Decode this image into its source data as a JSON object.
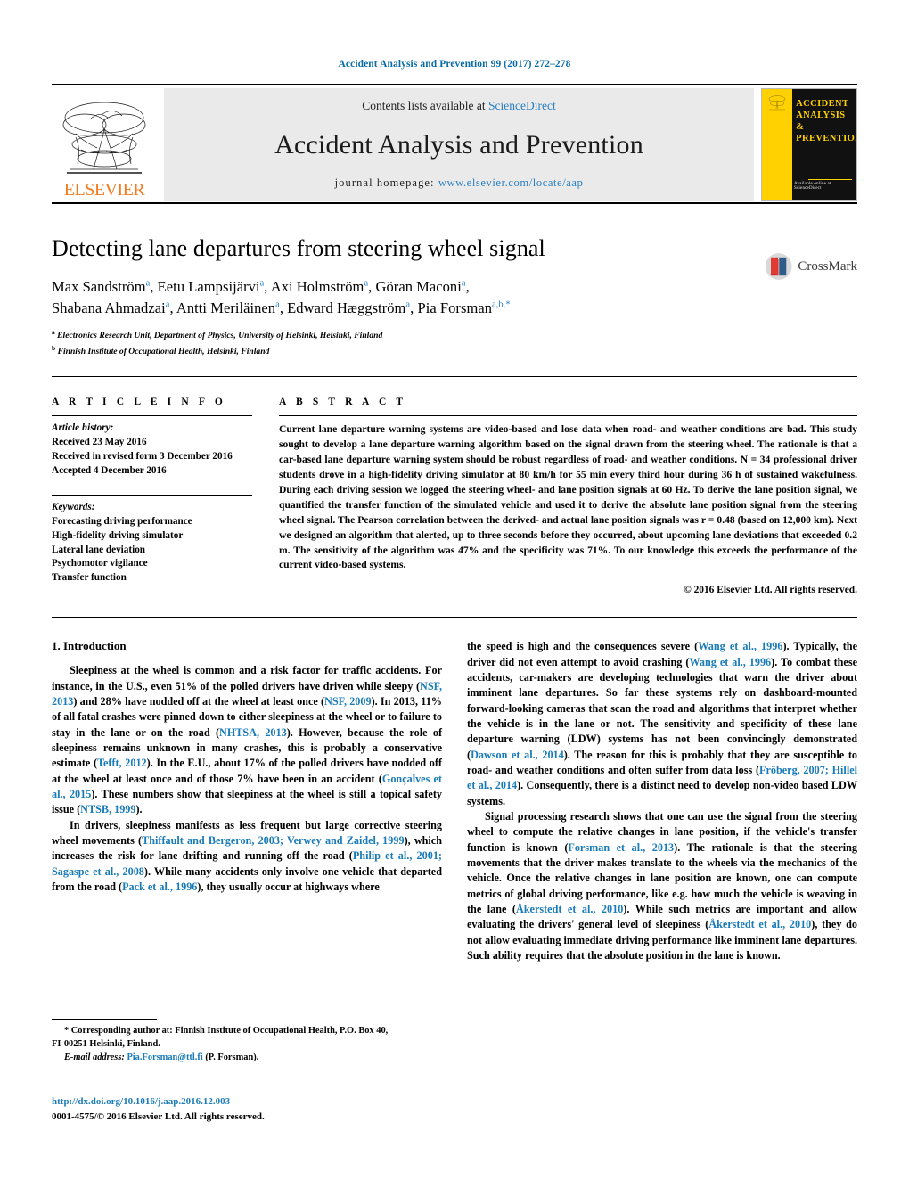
{
  "running_head": "Accident Analysis and Prevention 99 (2017) 272–278",
  "masthead": {
    "publisher": "ELSEVIER",
    "contents_prefix": "Contents lists available at ",
    "contents_link": "ScienceDirect",
    "journal_title": "Accident Analysis and Prevention",
    "homepage_label": "journal homepage:",
    "homepage_url": "www.elsevier.com/locate/aap",
    "cover_title": "ACCIDENT ANALYSIS & PREVENTION",
    "cover_title_lines": [
      "ACCIDENT",
      "ANALYSIS",
      "&",
      "PREVENTION"
    ],
    "cover_sd": "Available online at ScienceDirect"
  },
  "crossmark": {
    "label": "CrossMark"
  },
  "article": {
    "title": "Detecting lane departures from steering wheel signal",
    "authors_line1": "Max Sandström<sup>a</sup>, Eetu Lampsijärvi<sup>a</sup>, Axi Holmström<sup>a</sup>, Göran Maconi<sup>a</sup>,",
    "authors_line2": "Shabana Ahmadzai<sup>a</sup>, Antti Meriläinen<sup>a</sup>, Edward Hæggström<sup>a</sup>, Pia Forsman<sup>a,b,</sup><sup>*</sup>",
    "affiliation_a": "<sup>a</sup> Electronics Research Unit, Department of Physics, University of Helsinki, Helsinki, Finland",
    "affiliation_b": "<sup>b</sup> Finnish Institute of Occupational Health, Helsinki, Finland"
  },
  "article_info": {
    "heading": "A R T I C L E  I N F O",
    "history_label": "Article history:",
    "history": [
      "Received 23 May 2016",
      "Received in revised form 3 December 2016",
      "Accepted 4 December 2016"
    ],
    "keywords_label": "Keywords:",
    "keywords": [
      "Forecasting driving performance",
      "High-fidelity driving simulator",
      "Lateral lane deviation",
      "Psychomotor vigilance",
      "Transfer function"
    ]
  },
  "abstract": {
    "heading": "A B S T R A C T",
    "text": "Current lane departure warning systems are video-based and lose data when road- and weather conditions are bad. This study sought to develop a lane departure warning algorithm based on the signal drawn from the steering wheel. The rationale is that a car-based lane departure warning system should be robust regardless of road- and weather conditions. N = 34 professional driver students drove in a high-fidelity driving simulator at 80 km/h for 55 min every third hour during 36 h of sustained wakefulness. During each driving session we logged the steering wheel- and lane position signals at 60 Hz. To derive the lane position signal, we quantified the transfer function of the simulated vehicle and used it to derive the absolute lane position signal from the steering wheel signal. The Pearson correlation between the derived- and actual lane position signals was r = 0.48 (based on 12,000 km). Next we designed an algorithm that alerted, up to three seconds before they occurred, about upcoming lane deviations that exceeded 0.2 m. The sensitivity of the algorithm was 47% and the specificity was 71%. To our knowledge this exceeds the performance of the current video-based systems.",
    "copyright": "© 2016 Elsevier Ltd. All rights reserved."
  },
  "introduction": {
    "heading": "1. Introduction",
    "left_paragraphs": [
      "Sleepiness at the wheel is common and a risk factor for traffic accidents. For instance, in the U.S., even 51% of the polled drivers have driven while sleepy (<span class=\"ref\">NSF, 2013</span>) and 28% have nodded off at the wheel at least once (<span class=\"ref\">NSF, 2009</span>). In 2013, 11% of all fatal crashes were pinned down to either sleepiness at the wheel or to failure to stay in the lane or on the road (<span class=\"ref\">NHTSA, 2013</span>). However, because the role of sleepiness remains unknown in many crashes, this is probably a conservative estimate (<span class=\"ref\">Tefft, 2012</span>). In the E.U., about 17% of the polled drivers have nodded off at the wheel at least once and of those 7% have been in an accident (<span class=\"ref\">Gonçalves et al., 2015</span>). These numbers show that sleepiness at the wheel is still a topical safety issue (<span class=\"ref\">NTSB, 1999</span>).",
      "In drivers, sleepiness manifests as less frequent but large corrective steering wheel movements (<span class=\"ref\">Thiffault and Bergeron, 2003; Verwey and Zaidel, 1999</span>), which increases the risk for lane drifting and running off the road (<span class=\"ref\">Philip et al., 2001; Sagaspe et al., 2008</span>). While many accidents only involve one vehicle that departed from the road (<span class=\"ref\">Pack et al., 1996</span>), they usually occur at highways where"
    ],
    "right_paragraphs": [
      "the speed is high and the consequences severe (<span class=\"ref\">Wang et al., 1996</span>). Typically, the driver did not even attempt to avoid crashing (<span class=\"ref\">Wang et al., 1996</span>). To combat these accidents, car-makers are developing technologies that warn the driver about imminent lane departures. So far these systems rely on dashboard-mounted forward-looking cameras that scan the road and algorithms that interpret whether the vehicle is in the lane or not. The sensitivity and specificity of these lane departure warning (LDW) systems has not been convincingly demonstrated (<span class=\"ref\">Dawson et al., 2014</span>). The reason for this is probably that they are susceptible to road- and weather conditions and often suffer from data loss (<span class=\"ref\">Fröberg, 2007; Hillel et al., 2014</span>). Consequently, there is a distinct need to develop non-video based LDW systems.",
      "Signal processing research shows that one can use the signal from the steering wheel to compute the relative changes in lane position, if the vehicle's transfer function is known (<span class=\"ref\">Forsman et al., 2013</span>). The rationale is that the steering movements that the driver makes translate to the wheels via the mechanics of the vehicle. Once the relative changes in lane position are known, one can compute metrics of global driving performance, like e.g. how much the vehicle is weaving in the lane (<span class=\"ref\">Åkerstedt et al., 2010</span>). While such metrics are important and allow evaluating the drivers' general level of sleepiness (<span class=\"ref\">Åkerstedt et al., 2010</span>), they do not allow evaluating immediate driving performance like imminent lane departures. Such ability requires that the absolute position in the lane is known."
    ]
  },
  "footnote": {
    "line1": "* Corresponding author at: Finnish Institute of Occupational Health, P.O. Box 40,",
    "line2": "FI-00251 Helsinki, Finland.",
    "email_label": "E-mail address:",
    "email": "Pia.Forsman@ttl.fi",
    "email_suffix": "(P. Forsman)."
  },
  "doi": {
    "url": "http://dx.doi.org/10.1016/j.aap.2016.12.003",
    "issn_line": "0001-4575/© 2016 Elsevier Ltd. All rights reserved."
  },
  "colors": {
    "link_blue": "#1a7bb9",
    "header_blue": "#0b6ca5",
    "elsevier_orange": "#F47B20",
    "cover_yellow": "#FFD100",
    "masthead_gray": "#eaeaea"
  }
}
